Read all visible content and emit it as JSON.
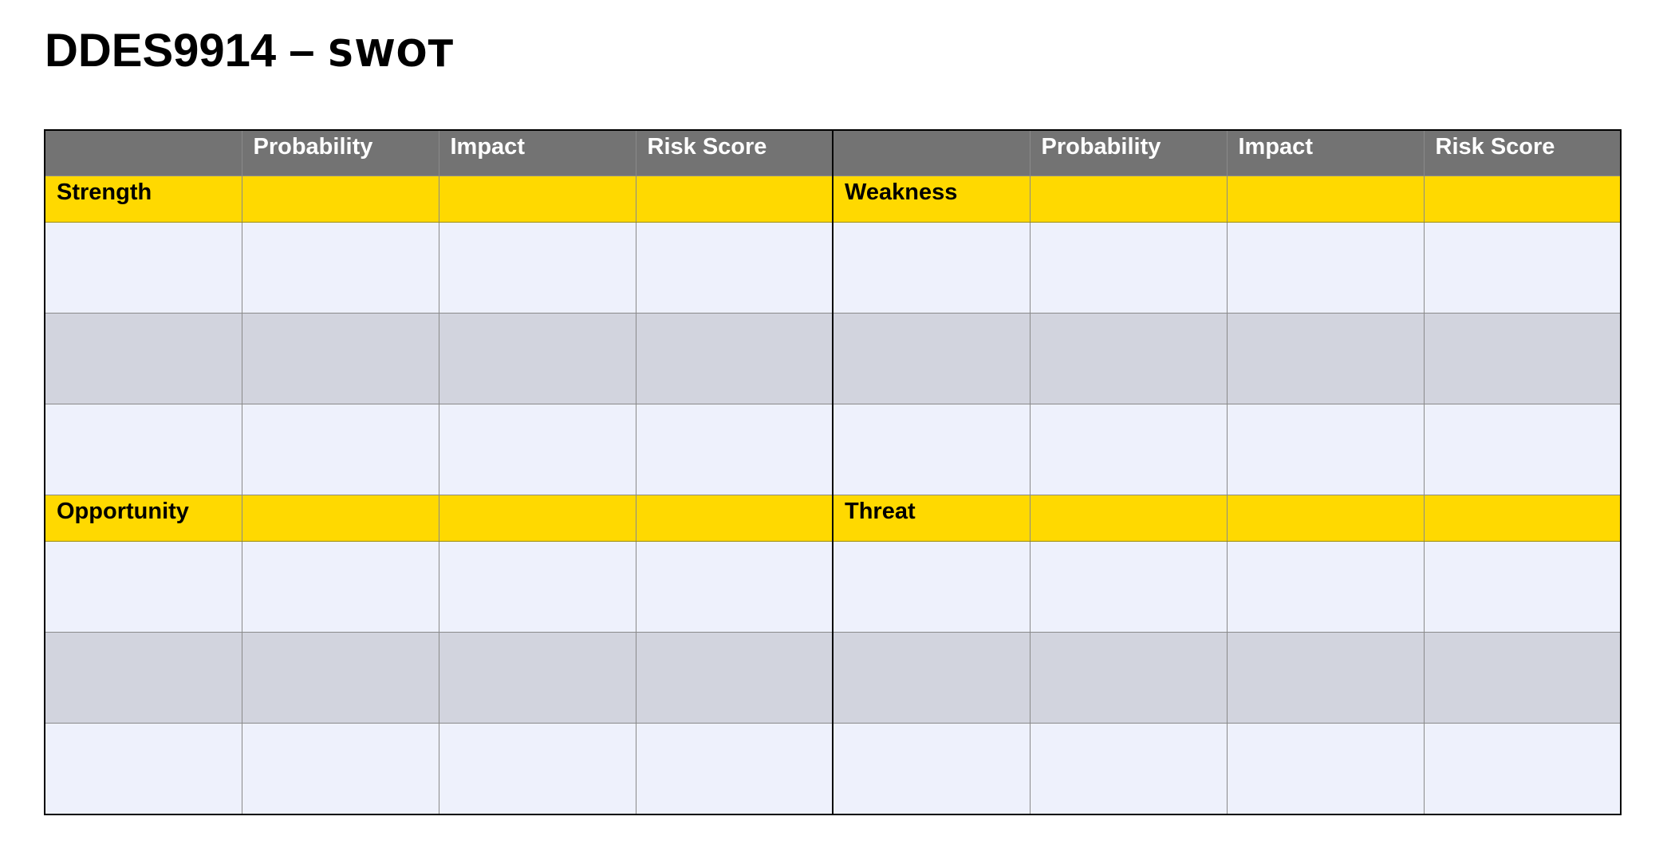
{
  "document": {
    "title_main": "DDES9914 – ",
    "title_sub": "SWOT"
  },
  "table": {
    "header": {
      "left": [
        "",
        "Probability",
        "Impact",
        "Risk Score"
      ],
      "right": [
        "",
        "Probability",
        "Impact",
        "Risk Score"
      ]
    },
    "sections": [
      {
        "left_label": "Strength",
        "right_label": "Weakness",
        "rows": [
          "light",
          "gray",
          "light"
        ]
      },
      {
        "left_label": "Opportunity",
        "right_label": "Threat",
        "rows": [
          "light",
          "gray",
          "light"
        ]
      }
    ]
  },
  "colors": {
    "header_bg": "#737373",
    "header_text": "#ffffff",
    "section_bg": "#ffd900",
    "row_light": "#eef1fc",
    "row_gray": "#d2d4de",
    "border": "#000000"
  }
}
